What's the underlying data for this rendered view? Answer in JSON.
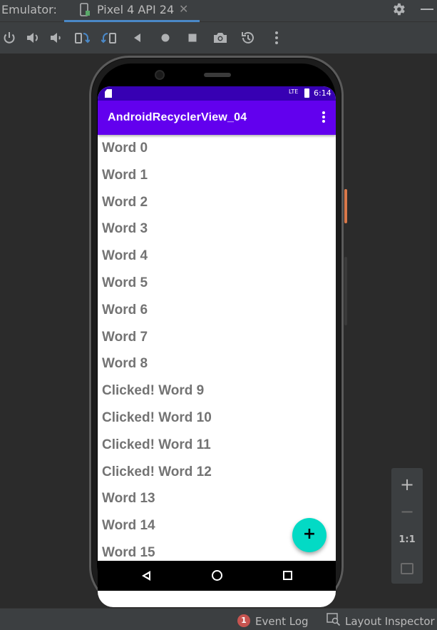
{
  "titlebar": {
    "label": "Emulator:",
    "tab_label": "Pixel 4 API 24",
    "tab_close": "✕"
  },
  "toolbar": {
    "icons": [
      "power-icon",
      "volume-up-icon",
      "volume-down-icon",
      "rotate-left-icon",
      "rotate-right-icon",
      "back-icon",
      "home-icon",
      "overview-icon",
      "screenshot-icon",
      "snapshot-icon",
      "more-icon"
    ]
  },
  "device": {
    "status_network": "LTE",
    "status_time": "6:14",
    "app_title": "AndroidRecyclerView_04",
    "accent_color": "#6200ee",
    "status_color": "#3700b3",
    "fab_color": "#03dac5",
    "fab_symbol": "+"
  },
  "list": {
    "items": [
      "Word 0",
      "Word 1",
      "Word 2",
      "Word 3",
      "Word 4",
      "Word 5",
      "Word 6",
      "Word 7",
      "Word 8",
      "Clicked! Word 9",
      "Clicked! Word 10",
      "Clicked! Word 11",
      "Clicked! Word 12",
      "Word 13",
      "Word 14",
      "Word 15"
    ]
  },
  "zoom": {
    "plus": "+",
    "minus": "−",
    "one_to_one": "1:1"
  },
  "bottombar": {
    "event_count": "1",
    "event_log": "Event Log",
    "layout_inspector": "Layout Inspector"
  }
}
